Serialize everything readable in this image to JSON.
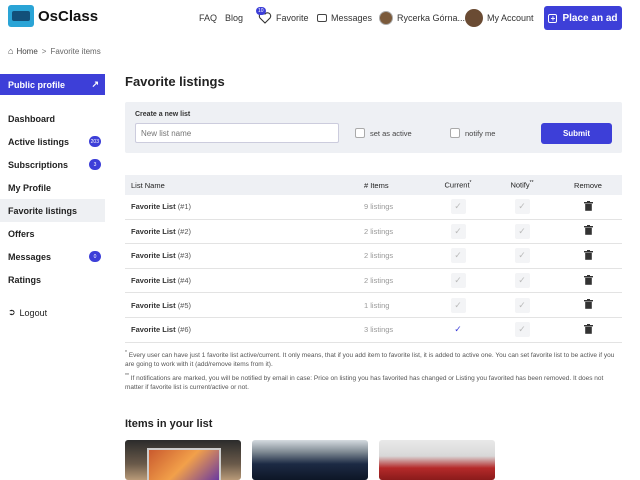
{
  "header": {
    "logo_text": "OsClass",
    "nav": {
      "faq": "FAQ",
      "blog": "Blog",
      "favorite": "Favorite",
      "favorite_badge": "10",
      "messages": "Messages",
      "user_name": "Rycerka Górna...",
      "my_account": "My Account"
    },
    "place_ad": "Place an ad"
  },
  "breadcrumb": {
    "home": "Home",
    "separator": ">",
    "current": "Favorite items"
  },
  "sidebar": {
    "public_profile": "Public profile",
    "items": [
      {
        "label": "Dashboard",
        "badge": null
      },
      {
        "label": "Active listings",
        "badge": "203"
      },
      {
        "label": "Subscriptions",
        "badge": "3"
      },
      {
        "label": "My Profile",
        "badge": null
      },
      {
        "label": "Favorite listings",
        "badge": null
      },
      {
        "label": "Offers",
        "badge": null
      },
      {
        "label": "Messages",
        "badge": "0"
      },
      {
        "label": "Ratings",
        "badge": null
      }
    ],
    "logout": "Logout"
  },
  "main": {
    "title": "Favorite listings",
    "new_list": {
      "label": "Create a new list",
      "placeholder": "New list name",
      "set_active": "set as active",
      "notify": "notify me",
      "submit": "Submit"
    },
    "table": {
      "headers": {
        "name": "List Name",
        "items": "# Items",
        "current": "Current",
        "notify": "Notify",
        "remove": "Remove"
      },
      "rows": [
        {
          "name": "Favorite List",
          "num": "(#1)",
          "items": "9 listings",
          "current": false,
          "notify": false
        },
        {
          "name": "Favorite List",
          "num": "(#2)",
          "items": "2 listings",
          "current": false,
          "notify": false
        },
        {
          "name": "Favorite List",
          "num": "(#3)",
          "items": "2 listings",
          "current": false,
          "notify": false
        },
        {
          "name": "Favorite List",
          "num": "(#4)",
          "items": "2 listings",
          "current": false,
          "notify": false
        },
        {
          "name": "Favorite List",
          "num": "(#5)",
          "items": "1 listing",
          "current": false,
          "notify": false
        },
        {
          "name": "Favorite List",
          "num": "(#6)",
          "items": "3 listings",
          "current": true,
          "notify": false
        }
      ]
    },
    "notes": {
      "note1": "Every user can have just 1 favorite list active/current. It only means, that if you add item to favorite list, it is added to active one. You can set favorite list to be active if you are going to work with it (add/remove items from it).",
      "note2": "If notifications are marked, you will be notified by email in case: Price on listing you has favorited has changed or Listing you favorited has been removed. It does not matter if favorite list is current/active or not."
    },
    "items_title": "Items in your list"
  },
  "colors": {
    "accent": "#3d3fd8"
  }
}
